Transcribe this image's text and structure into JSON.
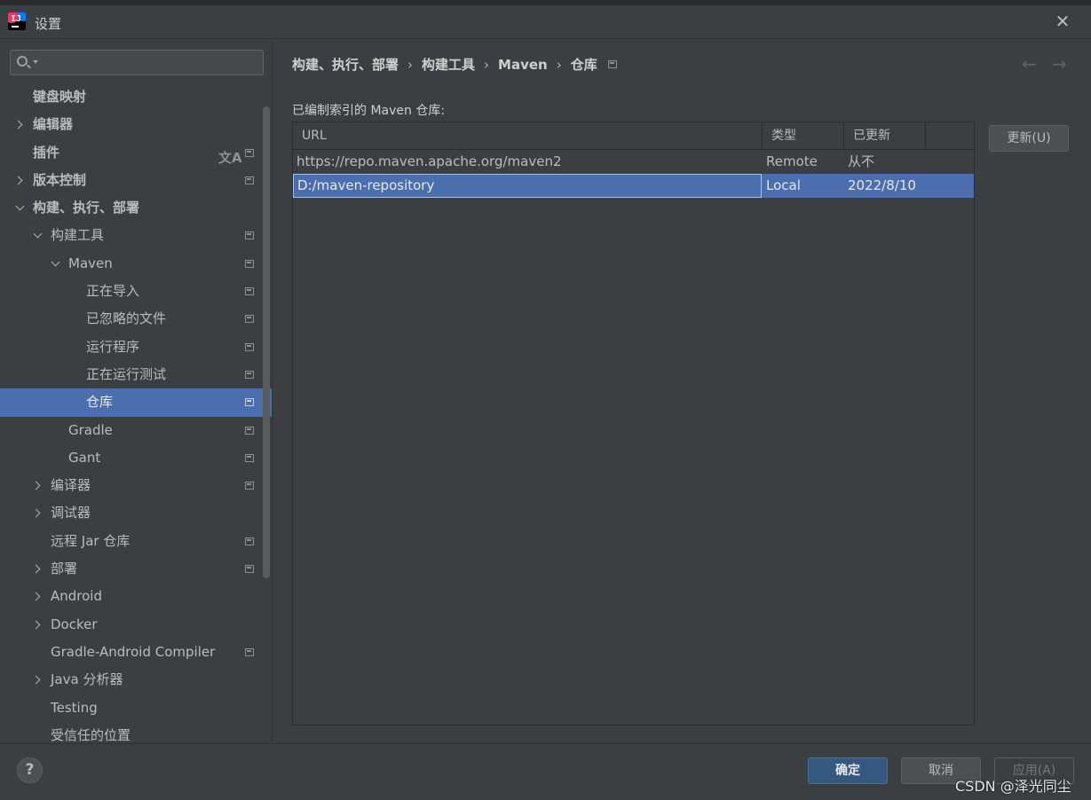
{
  "window": {
    "title": "设置"
  },
  "search": {
    "placeholder": "",
    "value": ""
  },
  "sidebar": {
    "items": [
      {
        "label": "键盘映射",
        "bold": true
      },
      {
        "label": "编辑器",
        "bold": true
      },
      {
        "label": "插件",
        "bold": true
      },
      {
        "label": "版本控制",
        "bold": true
      },
      {
        "label": "构建、执行、部署",
        "bold": true
      },
      {
        "label": "构建工具"
      },
      {
        "label": "Maven"
      },
      {
        "label": "正在导入"
      },
      {
        "label": "已忽略的文件"
      },
      {
        "label": "运行程序"
      },
      {
        "label": "正在运行测试"
      },
      {
        "label": "仓库",
        "selected": true
      },
      {
        "label": "Gradle"
      },
      {
        "label": "Gant"
      },
      {
        "label": "编译器"
      },
      {
        "label": "调试器"
      },
      {
        "label": "远程 Jar 仓库"
      },
      {
        "label": "部署"
      },
      {
        "label": "Android"
      },
      {
        "label": "Docker"
      },
      {
        "label": "Gradle-Android Compiler"
      },
      {
        "label": "Java 分析器"
      },
      {
        "label": "Testing"
      },
      {
        "label": "受信任的位置"
      }
    ]
  },
  "breadcrumb": [
    "构建、执行、部署",
    "构建工具",
    "Maven",
    "仓库"
  ],
  "main": {
    "section_label": "已编制索引的 Maven 仓库:",
    "update_label": "更新(U)",
    "table": {
      "headers": [
        "URL",
        "类型",
        "已更新"
      ],
      "rows": [
        {
          "url": "https://repo.maven.apache.org/maven2",
          "type": "Remote",
          "updated": "从不"
        },
        {
          "url": "D:/maven-repository",
          "type": "Local",
          "updated": "2022/8/10",
          "selected": true
        }
      ]
    }
  },
  "footer": {
    "help_label": "?",
    "ok_label": "确定",
    "cancel_label": "取消",
    "apply_label": "应用(A)",
    "watermark": "CSDN @泽光同尘"
  },
  "colors": {
    "background": "#3c3f41",
    "selection": "#4b6eaf",
    "primary_button": "#365880"
  }
}
